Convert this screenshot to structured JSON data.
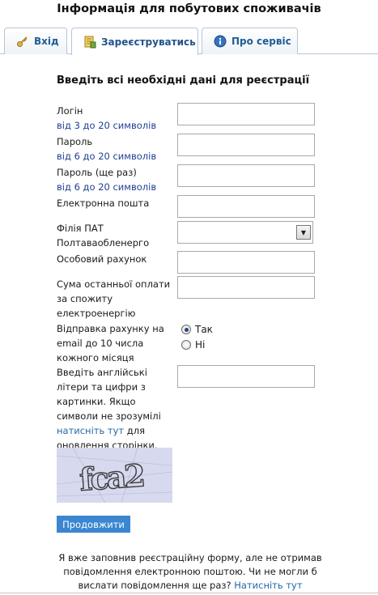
{
  "page": {
    "title": "Інформація для побутових споживачів"
  },
  "tabs": [
    {
      "label": "Вхід",
      "icon": "key-icon"
    },
    {
      "label": "Зареєструватись",
      "icon": "register-icon"
    },
    {
      "label": "Про сервіс",
      "icon": "info-icon"
    }
  ],
  "form": {
    "heading": "Введіть всі необхідні дані для реєстрації",
    "login": {
      "label": "Логін",
      "hint": "від 3 до 20 символів",
      "value": ""
    },
    "password": {
      "label": "Пароль",
      "hint": "від 6 до 20 символів",
      "value": ""
    },
    "password_repeat": {
      "label": "Пароль (ще раз)",
      "hint": "від 6 до 20 символів",
      "value": ""
    },
    "email": {
      "label": "Електронна пошта",
      "value": ""
    },
    "branch": {
      "label_line1": "Філія ПАТ",
      "label_line2": "Полтаваобленерго",
      "selected": ""
    },
    "account": {
      "label": "Особовий рахунок",
      "value": ""
    },
    "last_payment": {
      "label_line1": "Сума останньої оплати",
      "label_line2": "за спожиту",
      "label_line3": "електроенергію",
      "value": ""
    },
    "email_bill": {
      "label_line1": "Відправка рахунку на",
      "label_line2": "email до 10 числа",
      "label_line3": "кожного місяця",
      "options": [
        "Так",
        "Ні"
      ],
      "selected": "Так"
    },
    "captcha": {
      "label_line1": "Введіть англійські",
      "label_line2": "літери та цифри з",
      "label_line3": "картинки. Якщо",
      "label_line4": "символи не зрозумілі",
      "link": "натисніть тут",
      "label_line5_after_link": " для",
      "label_line6": "оновлення сторінки.",
      "image_text": "fca2",
      "value": ""
    },
    "submit_label": "Продовжити"
  },
  "footer": {
    "note_line1": "Я вже заповнив реєстраційну форму, але не отримав",
    "note_line2": "повідомлення електронною поштою. Чи не могли б",
    "note_line3_before_link": "вислати повідомлення ще раз? ",
    "note_link": "Натисніть тут"
  },
  "colors": {
    "accent": "#3a86d0",
    "link": "#2369a6",
    "hint": "#1e3f94",
    "tab_border": "#b9c6d6"
  }
}
